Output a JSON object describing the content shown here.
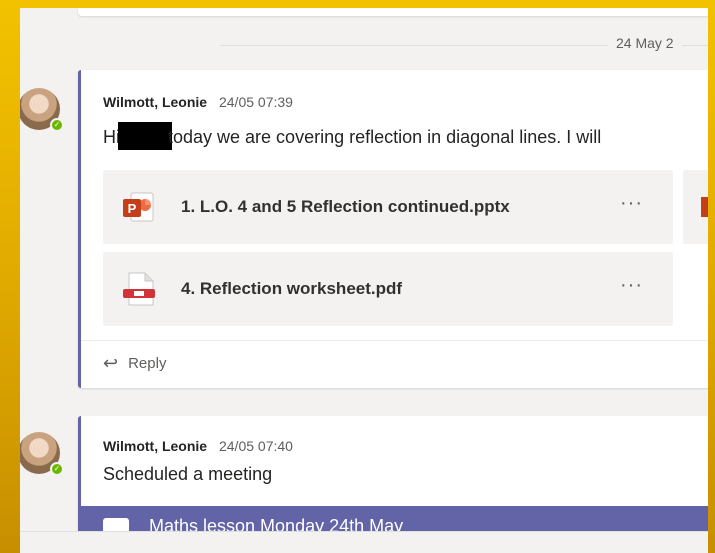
{
  "date_divider": {
    "label": "24 May 2"
  },
  "messages": [
    {
      "author": "Wilmott, Leonie",
      "time": "24/05 07:39",
      "text_before": "Hi",
      "text_after": "today we are covering reflection in diagonal lines. I will",
      "attachments": [
        {
          "name": "1. L.O. 4 and 5 Reflection continued.pptx",
          "type": "pptx",
          "more": "···"
        },
        {
          "name": "4. Reflection worksheet.pdf",
          "type": "pdf",
          "more": "···"
        }
      ],
      "reply_label": "Reply"
    },
    {
      "author": "Wilmott, Leonie",
      "time": "24/05 07:40",
      "text": "Scheduled a meeting",
      "meeting_title": "Maths lesson Monday 24th May"
    }
  ],
  "colors": {
    "accent": "#6264a7",
    "presence": "#6bb700",
    "powerpoint": "#c43e1c",
    "pdf": "#d13438"
  },
  "icons": [
    "avatar",
    "presence-available-icon",
    "powerpoint-file-icon",
    "pdf-file-icon",
    "more-options-icon",
    "reply-icon",
    "meeting-icon"
  ]
}
